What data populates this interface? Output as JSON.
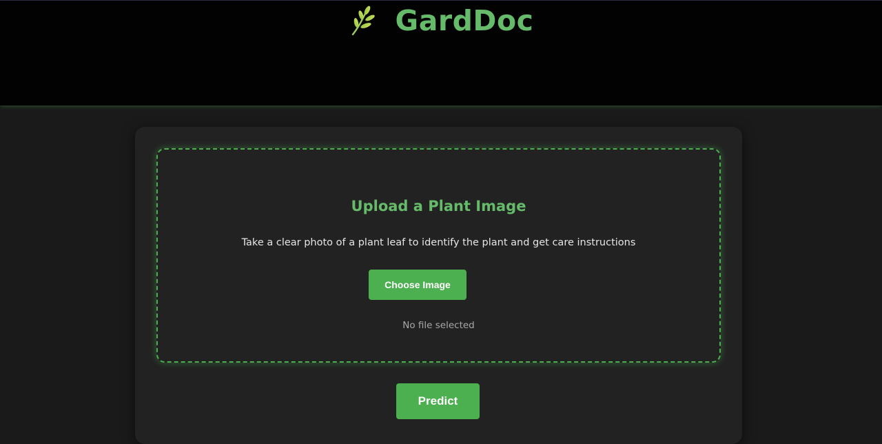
{
  "header": {
    "brand_title": "GardDoc",
    "brand_icon": "leaf-sprig-icon"
  },
  "upload": {
    "title": "Upload a Plant Image",
    "description": "Take a clear photo of a plant leaf to identify the plant and get care instructions",
    "choose_button_label": "Choose Image",
    "file_status": "No file selected"
  },
  "actions": {
    "predict_label": "Predict"
  },
  "colors": {
    "accent": "#4caf50",
    "brand_text": "#66bb6a",
    "header_bg": "#020202",
    "page_bg": "#1a1a1a",
    "card_bg": "#222222"
  }
}
